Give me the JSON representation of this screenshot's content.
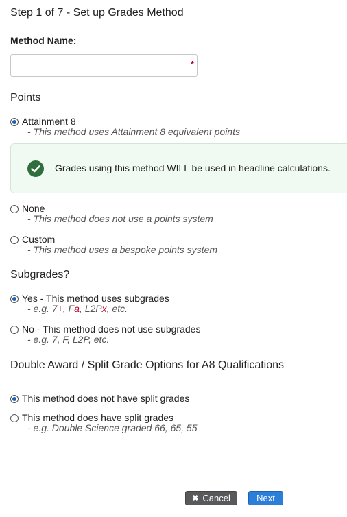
{
  "header": {
    "title": "Step 1 of 7 - Set up Grades Method"
  },
  "method_name": {
    "label": "Method Name:",
    "value": "",
    "placeholder": "",
    "required_mark": "*"
  },
  "points": {
    "heading": "Points",
    "options": [
      {
        "label": "Attainment 8",
        "desc": "- This method uses Attainment 8 equivalent points",
        "selected": true
      },
      {
        "label": "None",
        "desc": "- This method does not use a points system",
        "selected": false
      },
      {
        "label": "Custom",
        "desc": "- This method uses a bespoke points system",
        "selected": false
      }
    ],
    "notice": {
      "icon": "check-circle-icon",
      "text": "Grades using this method WILL be used in headline calculations."
    }
  },
  "subgrades": {
    "heading": "Subgrades?",
    "yes": {
      "label": "Yes - This method uses subgrades",
      "selected": true,
      "desc": {
        "prefix": "- e.g. 7",
        "m1": "+",
        "sep1": ", F",
        "m2": "a",
        "sep2": ", L2P",
        "m3": "x",
        "suffix": ", etc."
      }
    },
    "no": {
      "label": "No - This method does not use subgrades",
      "selected": false,
      "desc": "- e.g. 7, F, L2P, etc."
    }
  },
  "split": {
    "heading": "Double Award / Split Grade Options for A8 Qualifications",
    "options": [
      {
        "label": "This method does not have split grades",
        "selected": true
      },
      {
        "label": "This method does have split grades",
        "desc": "- e.g. Double Science graded 66, 65, 55",
        "selected": false
      }
    ]
  },
  "footer": {
    "cancel_label": "Cancel",
    "cancel_icon": "close-icon",
    "next_label": "Next"
  },
  "colors": {
    "radio_selected": "#1d5fb4",
    "required": "#b8002a",
    "notice_bg": "#f0f9f2",
    "check": "#2f6f3e",
    "cancel_bg": "#58595b",
    "next_bg": "#2b7fd8"
  }
}
